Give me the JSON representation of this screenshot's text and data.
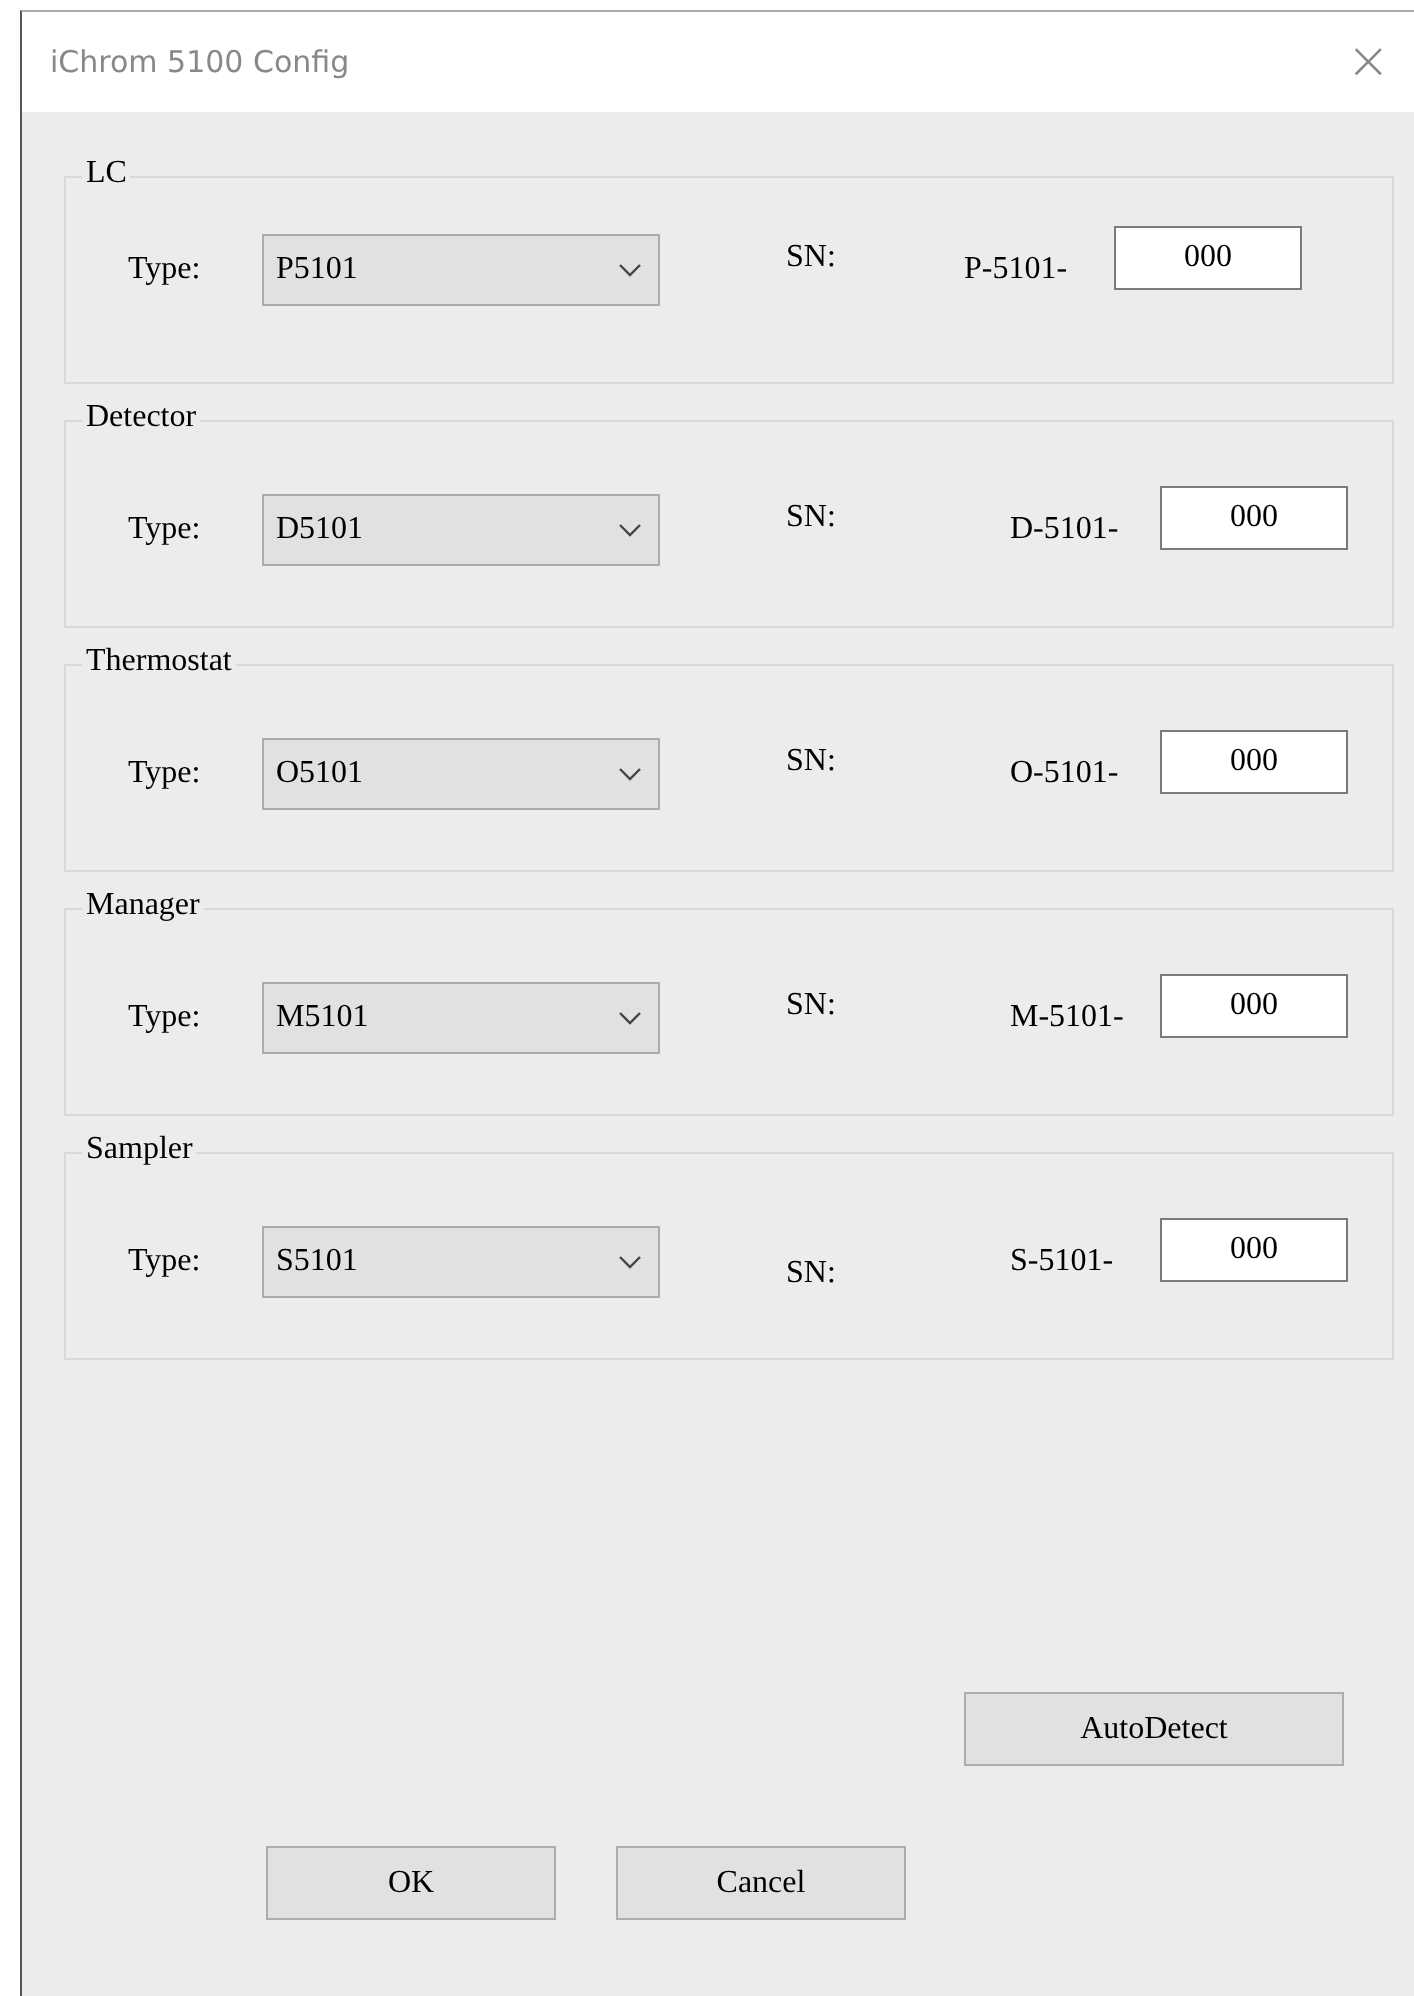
{
  "window": {
    "title": "iChrom 5100 Config",
    "close": "×"
  },
  "groups": [
    {
      "title": "LC",
      "type_label": "Type:",
      "type_value": "P5101",
      "sn_label": "SN:",
      "sn_prefix": "P-5101-",
      "sn_value": "000"
    },
    {
      "title": "Detector",
      "type_label": "Type:",
      "type_value": "D5101",
      "sn_label": "SN:",
      "sn_prefix": "D-5101-",
      "sn_value": "000"
    },
    {
      "title": "Thermostat",
      "type_label": "Type:",
      "type_value": "O5101",
      "sn_label": "SN:",
      "sn_prefix": "O-5101-",
      "sn_value": "000"
    },
    {
      "title": "Manager",
      "type_label": "Type:",
      "type_value": "M5101",
      "sn_label": "SN:",
      "sn_prefix": "M-5101-",
      "sn_value": "000"
    },
    {
      "title": "Sampler",
      "type_label": "Type:",
      "type_value": "S5101",
      "sn_label": "SN:",
      "sn_prefix": "S-5101-",
      "sn_value": "000"
    }
  ],
  "autodetect_button": "AutoDetect",
  "buttons": [
    "OK",
    "Cancel"
  ]
}
